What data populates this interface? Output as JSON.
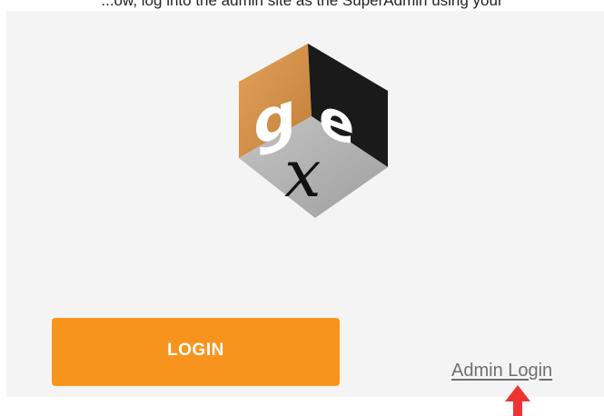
{
  "header": {
    "instruction_text": "...ow, log into the admin site as the SuperAdmin using your"
  },
  "logo": {
    "icon": "gex-cube-logo",
    "face_letters": [
      "g",
      "e",
      "x"
    ],
    "colors": {
      "left_face": "#d4914a",
      "right_face": "#1a1a1a",
      "bottom_face": "#b3b3b3"
    }
  },
  "login_button": {
    "label": "LOGIN",
    "color": "#f7941d"
  },
  "admin_login_link": {
    "label": "Admin Login"
  },
  "annotation": {
    "icon": "red-up-arrow",
    "color": "#ee3333"
  }
}
